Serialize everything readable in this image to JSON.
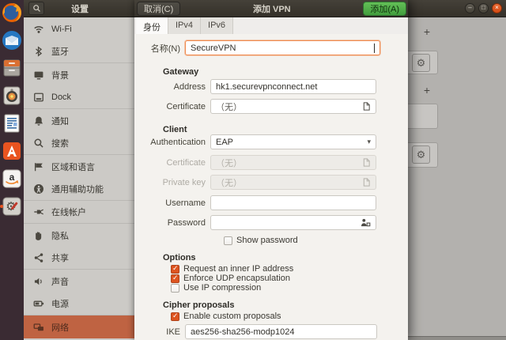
{
  "window": {
    "title": "设置",
    "controls": [
      {
        "name": "minimize",
        "glyph": "–"
      },
      {
        "name": "maximize",
        "glyph": "□"
      },
      {
        "name": "close",
        "glyph": "×"
      }
    ]
  },
  "sidebar": {
    "items": [
      {
        "name": "wifi",
        "label": "Wi-Fi",
        "icon": "wifi",
        "selected": false,
        "sep": false
      },
      {
        "name": "bluetooth",
        "label": "蓝牙",
        "icon": "bluetooth",
        "selected": false,
        "sep": true
      },
      {
        "name": "background",
        "label": "背景",
        "icon": "background",
        "selected": false,
        "sep": false
      },
      {
        "name": "dock",
        "label": "Dock",
        "icon": "dock",
        "selected": false,
        "sep": true
      },
      {
        "name": "notifications",
        "label": "通知",
        "icon": "notifications",
        "selected": false,
        "sep": false
      },
      {
        "name": "search",
        "label": "搜索",
        "icon": "search",
        "selected": false,
        "sep": true
      },
      {
        "name": "region-language",
        "label": "区域和语言",
        "icon": "region-language",
        "selected": false,
        "sep": false
      },
      {
        "name": "universal-access",
        "label": "通用辅助功能",
        "icon": "accessibility",
        "selected": false,
        "sep": true
      },
      {
        "name": "online-accounts",
        "label": "在线帐户",
        "icon": "online-accounts",
        "selected": false,
        "sep": true
      },
      {
        "name": "privacy",
        "label": "隐私",
        "icon": "privacy",
        "selected": false,
        "sep": false
      },
      {
        "name": "sharing",
        "label": "共享",
        "icon": "share",
        "selected": false,
        "sep": true
      },
      {
        "name": "sound",
        "label": "声音",
        "icon": "sound",
        "selected": false,
        "sep": false
      },
      {
        "name": "power",
        "label": "电源",
        "icon": "power",
        "selected": false,
        "sep": true
      },
      {
        "name": "network",
        "label": "网络",
        "icon": "network",
        "selected": true,
        "sep": false
      }
    ]
  },
  "dock": {
    "items": [
      {
        "name": "firefox",
        "running": false
      },
      {
        "name": "thunderbird",
        "running": false
      },
      {
        "name": "files",
        "running": false
      },
      {
        "name": "rhythmbox",
        "running": false
      },
      {
        "name": "libreoffice-writer",
        "running": false
      },
      {
        "name": "ubuntu-software",
        "running": false
      },
      {
        "name": "amazon",
        "running": false
      },
      {
        "name": "system-settings",
        "running": true
      }
    ]
  },
  "dialog": {
    "cancel_label": "取消(C)",
    "title": "添加 VPN",
    "add_label": "添加(A)",
    "tabs": [
      {
        "name": "identity",
        "label": "身份",
        "active": true
      },
      {
        "name": "ipv4",
        "label": "IPv4",
        "active": false
      },
      {
        "name": "ipv6",
        "label": "IPv6",
        "active": false
      }
    ],
    "form": {
      "name_label": "名称(N)",
      "name_value": "SecureVPN",
      "gateway": {
        "header": "Gateway",
        "address_label": "Address",
        "address_value": "hk1.securevpnconnect.net",
        "certificate_label": "Certificate",
        "certificate_value": "（无）"
      },
      "client": {
        "header": "Client",
        "authentication_label": "Authentication",
        "authentication_value": "EAP",
        "certificate_label": "Certificate",
        "certificate_value": "（无）",
        "private_key_label": "Private key",
        "private_key_value": "（无）",
        "username_label": "Username",
        "username_value": "",
        "password_label": "Password",
        "password_value": "",
        "show_password_label": "Show password",
        "show_password_checked": false
      },
      "options": {
        "header": "Options",
        "checkboxes": [
          {
            "label": "Request an inner IP address",
            "checked": true
          },
          {
            "label": "Enforce UDP encapsulation",
            "checked": true
          },
          {
            "label": "Use IP compression",
            "checked": false
          }
        ]
      },
      "cipher": {
        "header": "Cipher proposals",
        "enable_label": "Enable custom proposals",
        "enable_checked": true,
        "ike_label": "IKE",
        "ike_value": "aes256-sha256-modp1024"
      }
    }
  },
  "background_panel": {
    "add_button_glyph": "+",
    "gear_glyph": "⚙",
    "rows": [
      {
        "gear": true
      },
      {
        "gear": false
      },
      {
        "gear": true
      }
    ]
  },
  "colors": {
    "accent_orange": "#e95420",
    "suggested_green": "#4aa24a",
    "checkbox_checked": "#dd5420",
    "sidebar_selected": "#bf6342",
    "focus_border": "#ef8a4e"
  }
}
